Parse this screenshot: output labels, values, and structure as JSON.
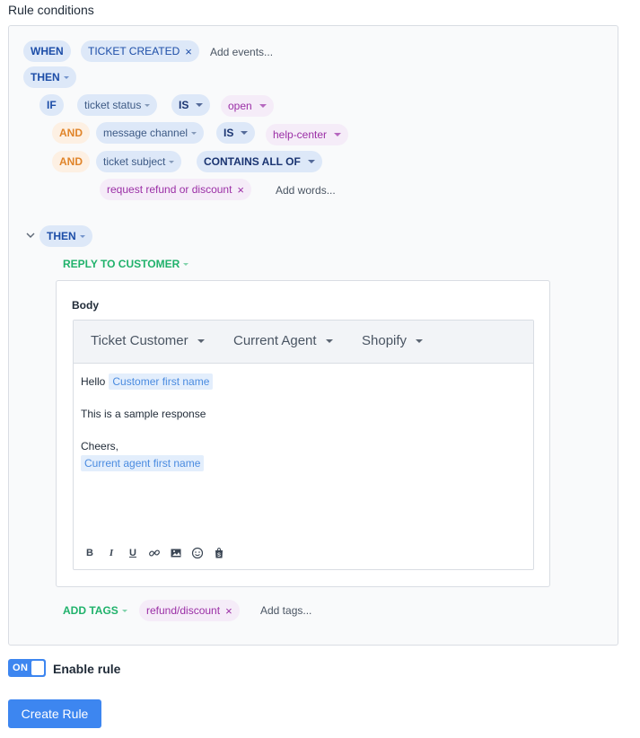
{
  "page": {
    "title": "Rule conditions"
  },
  "trigger": {
    "when_label": "WHEN",
    "event_label": "TICKET CREATED",
    "add_events_placeholder": "Add events...",
    "then_label": "THEN"
  },
  "conditions": {
    "if_label": "IF",
    "rows": [
      {
        "connector": "IF",
        "field": "ticket status",
        "operator": "IS",
        "value": "open"
      },
      {
        "connector": "AND",
        "field": "message channel",
        "operator": "IS",
        "value": "help-center"
      },
      {
        "connector": "AND",
        "field": "ticket subject",
        "operator": "CONTAINS ALL OF",
        "value": ""
      }
    ],
    "words": [
      "request refund or discount"
    ],
    "add_words_placeholder": "Add words..."
  },
  "actions": {
    "then_label": "THEN",
    "reply_label": "REPLY TO CUSTOMER",
    "body_label": "Body",
    "variable_menus": [
      "Ticket Customer",
      "Current Agent",
      "Shopify"
    ],
    "body": {
      "greeting": "Hello",
      "customer_var": "Customer first name",
      "line2": "This is a sample response",
      "signoff": "Cheers,",
      "agent_var": "Current agent first name"
    },
    "toolbar": {
      "bold": "B",
      "italic": "I",
      "underline": "U"
    },
    "add_tags_label": "ADD TAGS",
    "tags": [
      "refund/discount"
    ],
    "add_tags_placeholder": "Add tags..."
  },
  "footer": {
    "toggle_state": "ON",
    "enable_label": "Enable rule",
    "create_label": "Create Rule"
  },
  "colors": {
    "accent": "#3d86f0",
    "condition_pill": "#dde8f8",
    "and_pill": "#fdf0e3",
    "value_pill": "#f5ecf8",
    "action_green": "#20b26b"
  }
}
